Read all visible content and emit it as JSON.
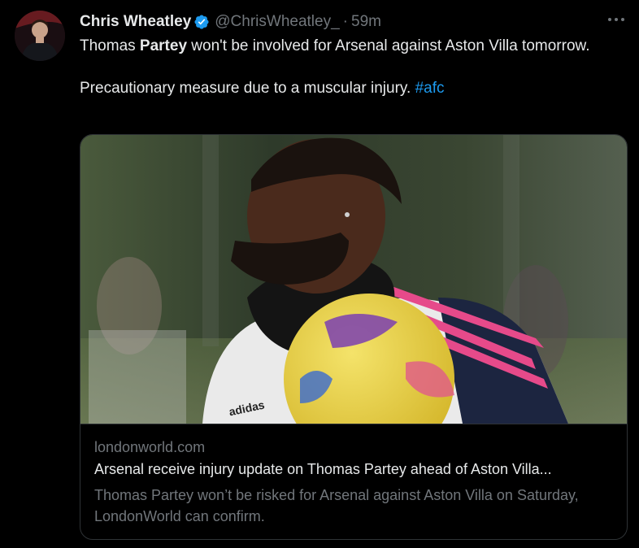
{
  "tweet": {
    "author_name": "Chris Wheatley",
    "handle": "@ChrisWheatley_",
    "separator": "·",
    "time": "59m",
    "text_part1": "Thomas ",
    "text_bold": "Partey",
    "text_part2": " won't be involved for Arsenal against Aston Villa tomorrow.",
    "text_line2": "Precautionary measure due to a muscular injury. ",
    "hashtag": "#afc"
  },
  "card": {
    "domain": "londonworld.com",
    "title": "Arsenal receive injury update on Thomas Partey ahead of Aston Villa...",
    "description": "Thomas Partey won’t be risked for Arsenal against Aston Villa on Saturday, LondonWorld can confirm.",
    "image_brand_text": "adidas"
  },
  "colors": {
    "background": "#000000",
    "text_primary": "#e7e9ea",
    "text_secondary": "#71767b",
    "link": "#1d9bf0",
    "verified": "#1d9bf0",
    "border": "#2f3336"
  },
  "icons": {
    "verified": "verified-badge-icon",
    "more": "more-options-icon"
  }
}
